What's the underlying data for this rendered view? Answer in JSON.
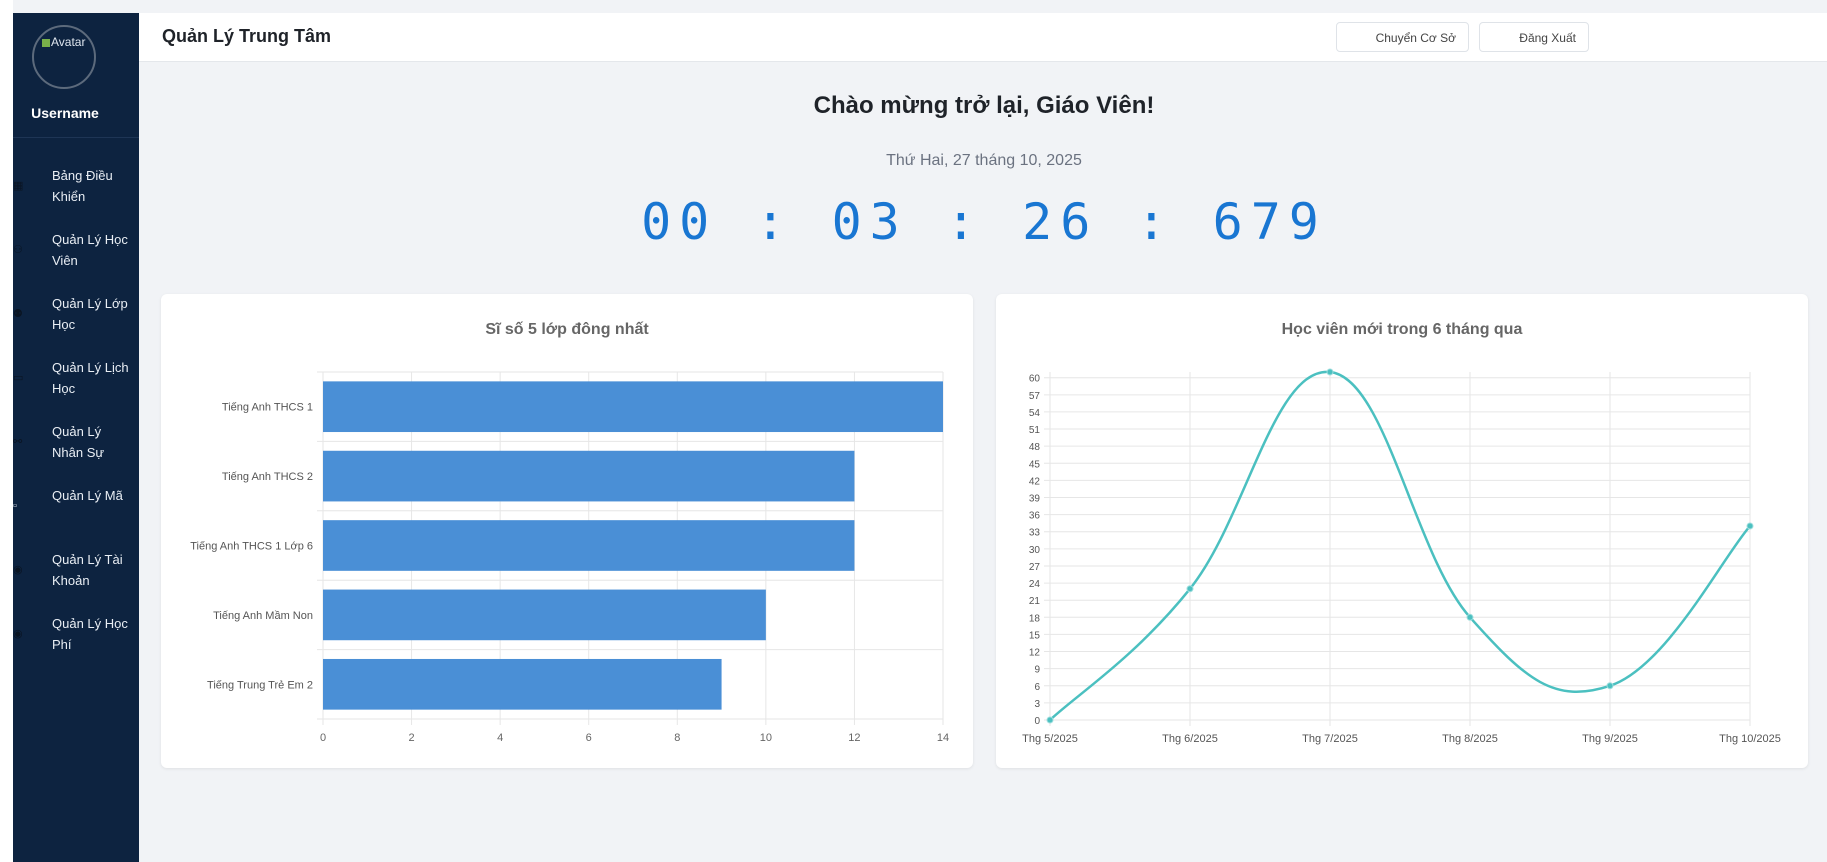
{
  "sidebar": {
    "avatar_alt": "Avatar",
    "username": "Username",
    "items": [
      {
        "label": "Bảng Điều Khiển",
        "icon": "dashboard-icon"
      },
      {
        "label": "Quản Lý Học Viên",
        "icon": "students-icon"
      },
      {
        "label": "Quản Lý Lớp Học",
        "icon": "classroom-icon"
      },
      {
        "label": "Quản Lý Lịch Học",
        "icon": "calendar-icon"
      },
      {
        "label": "Quản Lý Nhân Sự",
        "icon": "staff-icon"
      },
      {
        "label": "Quản Lý Mã",
        "icon": "broken-image-icon"
      },
      {
        "label": "Quản Lý Tài Khoản",
        "icon": "account-icon"
      },
      {
        "label": "Quản Lý Học Phí",
        "icon": "fee-icon"
      }
    ]
  },
  "header": {
    "title": "Quản Lý Trung Tâm",
    "switch_branch_label": "Chuyển Cơ Sở",
    "logout_label": "Đăng Xuất"
  },
  "main": {
    "welcome": "Chào mừng trở lại, Giáo Viên!",
    "date": "Thứ Hai, 27 tháng 10, 2025",
    "clock": "00 : 03 : 26 : 679"
  },
  "colors": {
    "sidebar_bg": "#0d2340",
    "bar": "#4a8fd6",
    "line": "#4bc0c0",
    "clock": "#1976d2"
  },
  "chart_data": [
    {
      "type": "bar",
      "orientation": "horizontal",
      "title": "Sĩ số 5 lớp đông nhất",
      "categories": [
        "Tiếng Anh THCS 1",
        "Tiếng Anh THCS 2",
        "Tiếng Anh THCS 1 Lớp 6",
        "Tiếng Anh Mầm Non",
        "Tiếng Trung Trẻ Em 2"
      ],
      "values": [
        14,
        12,
        12,
        10,
        9
      ],
      "xlim": [
        0,
        14
      ],
      "xticks": [
        "0",
        "2",
        "4",
        "6",
        "8",
        "10",
        "12",
        "14"
      ],
      "grid": true
    },
    {
      "type": "line",
      "title": "Học viên mới trong 6 tháng qua",
      "categories": [
        "Thg 5/2025",
        "Thg 6/2025",
        "Thg 7/2025",
        "Thg 8/2025",
        "Thg 9/2025",
        "Thg 10/2025"
      ],
      "values": [
        0,
        23,
        61,
        18,
        6,
        34
      ],
      "ylim": [
        0,
        61
      ],
      "yticks": [
        "0",
        "3",
        "6",
        "9",
        "12",
        "15",
        "18",
        "21",
        "24",
        "27",
        "30",
        "33",
        "36",
        "39",
        "42",
        "45",
        "48",
        "51",
        "54",
        "57",
        "60"
      ],
      "grid": true
    }
  ]
}
